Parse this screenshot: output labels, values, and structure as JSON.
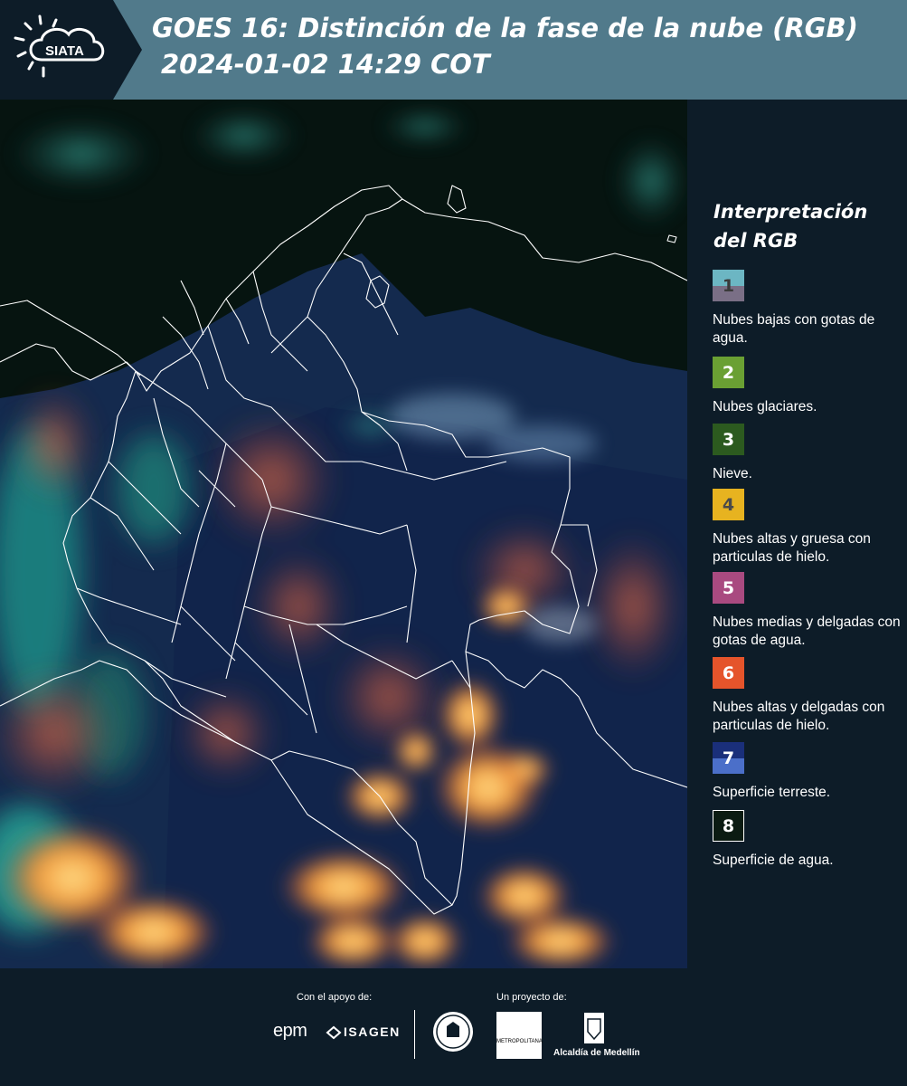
{
  "header": {
    "title_line1": "GOES 16: Distinción de la fase de la nube (RGB)",
    "title_line2": "2024-01-02 14:29 COT",
    "logo_text": "SIATA",
    "bg_color": "#517a8b"
  },
  "legend": {
    "title": "Interpretación\ndel RGB",
    "items": [
      {
        "number": "1",
        "label": "Nubes bajas con gotas de agua.",
        "color_top": "#6cb6c3",
        "color_bottom": "#7a6f86",
        "num_color": "#3a3a3a"
      },
      {
        "number": "2",
        "label": "Nubes glaciares.",
        "color_top": "#6aa033",
        "color_bottom": "#6aa033",
        "num_color": "#ffffff"
      },
      {
        "number": "3",
        "label": "Nieve.",
        "color_top": "#2c5a1f",
        "color_bottom": "#2c5a1f",
        "num_color": "#ffffff"
      },
      {
        "number": "4",
        "label": "Nubes altas y gruesa con particulas de hielo.",
        "color_top": "#e7b320",
        "color_bottom": "#e7b320",
        "num_color": "#4a4a4a"
      },
      {
        "number": "5",
        "label": "Nubes medias y delgadas con gotas de agua.",
        "color_top": "#a94a80",
        "color_bottom": "#a94a80",
        "num_color": "#ffffff"
      },
      {
        "number": "6",
        "label": "Nubes altas y delgadas con particulas de hielo.",
        "color_top": "#e5542b",
        "color_bottom": "#e5542b",
        "num_color": "#ffffff"
      },
      {
        "number": "7",
        "label": "Superficie terreste.",
        "color_top": "#1a2f7a",
        "color_bottom": "#4b6fc9",
        "num_color": "#ffffff"
      },
      {
        "number": "8",
        "label": "Superficie de agua.",
        "color_top": "#0b1b12",
        "color_bottom": "#0b1b12",
        "num_color": "#ffffff"
      }
    ]
  },
  "footer": {
    "support_label": "Con el apoyo de:",
    "project_label": "Un proyecto de:",
    "epm": "epm",
    "isagen": "ISAGEN",
    "amva": "METROPOLITANA",
    "alcaldia": "Alcaldía de Medellín"
  }
}
